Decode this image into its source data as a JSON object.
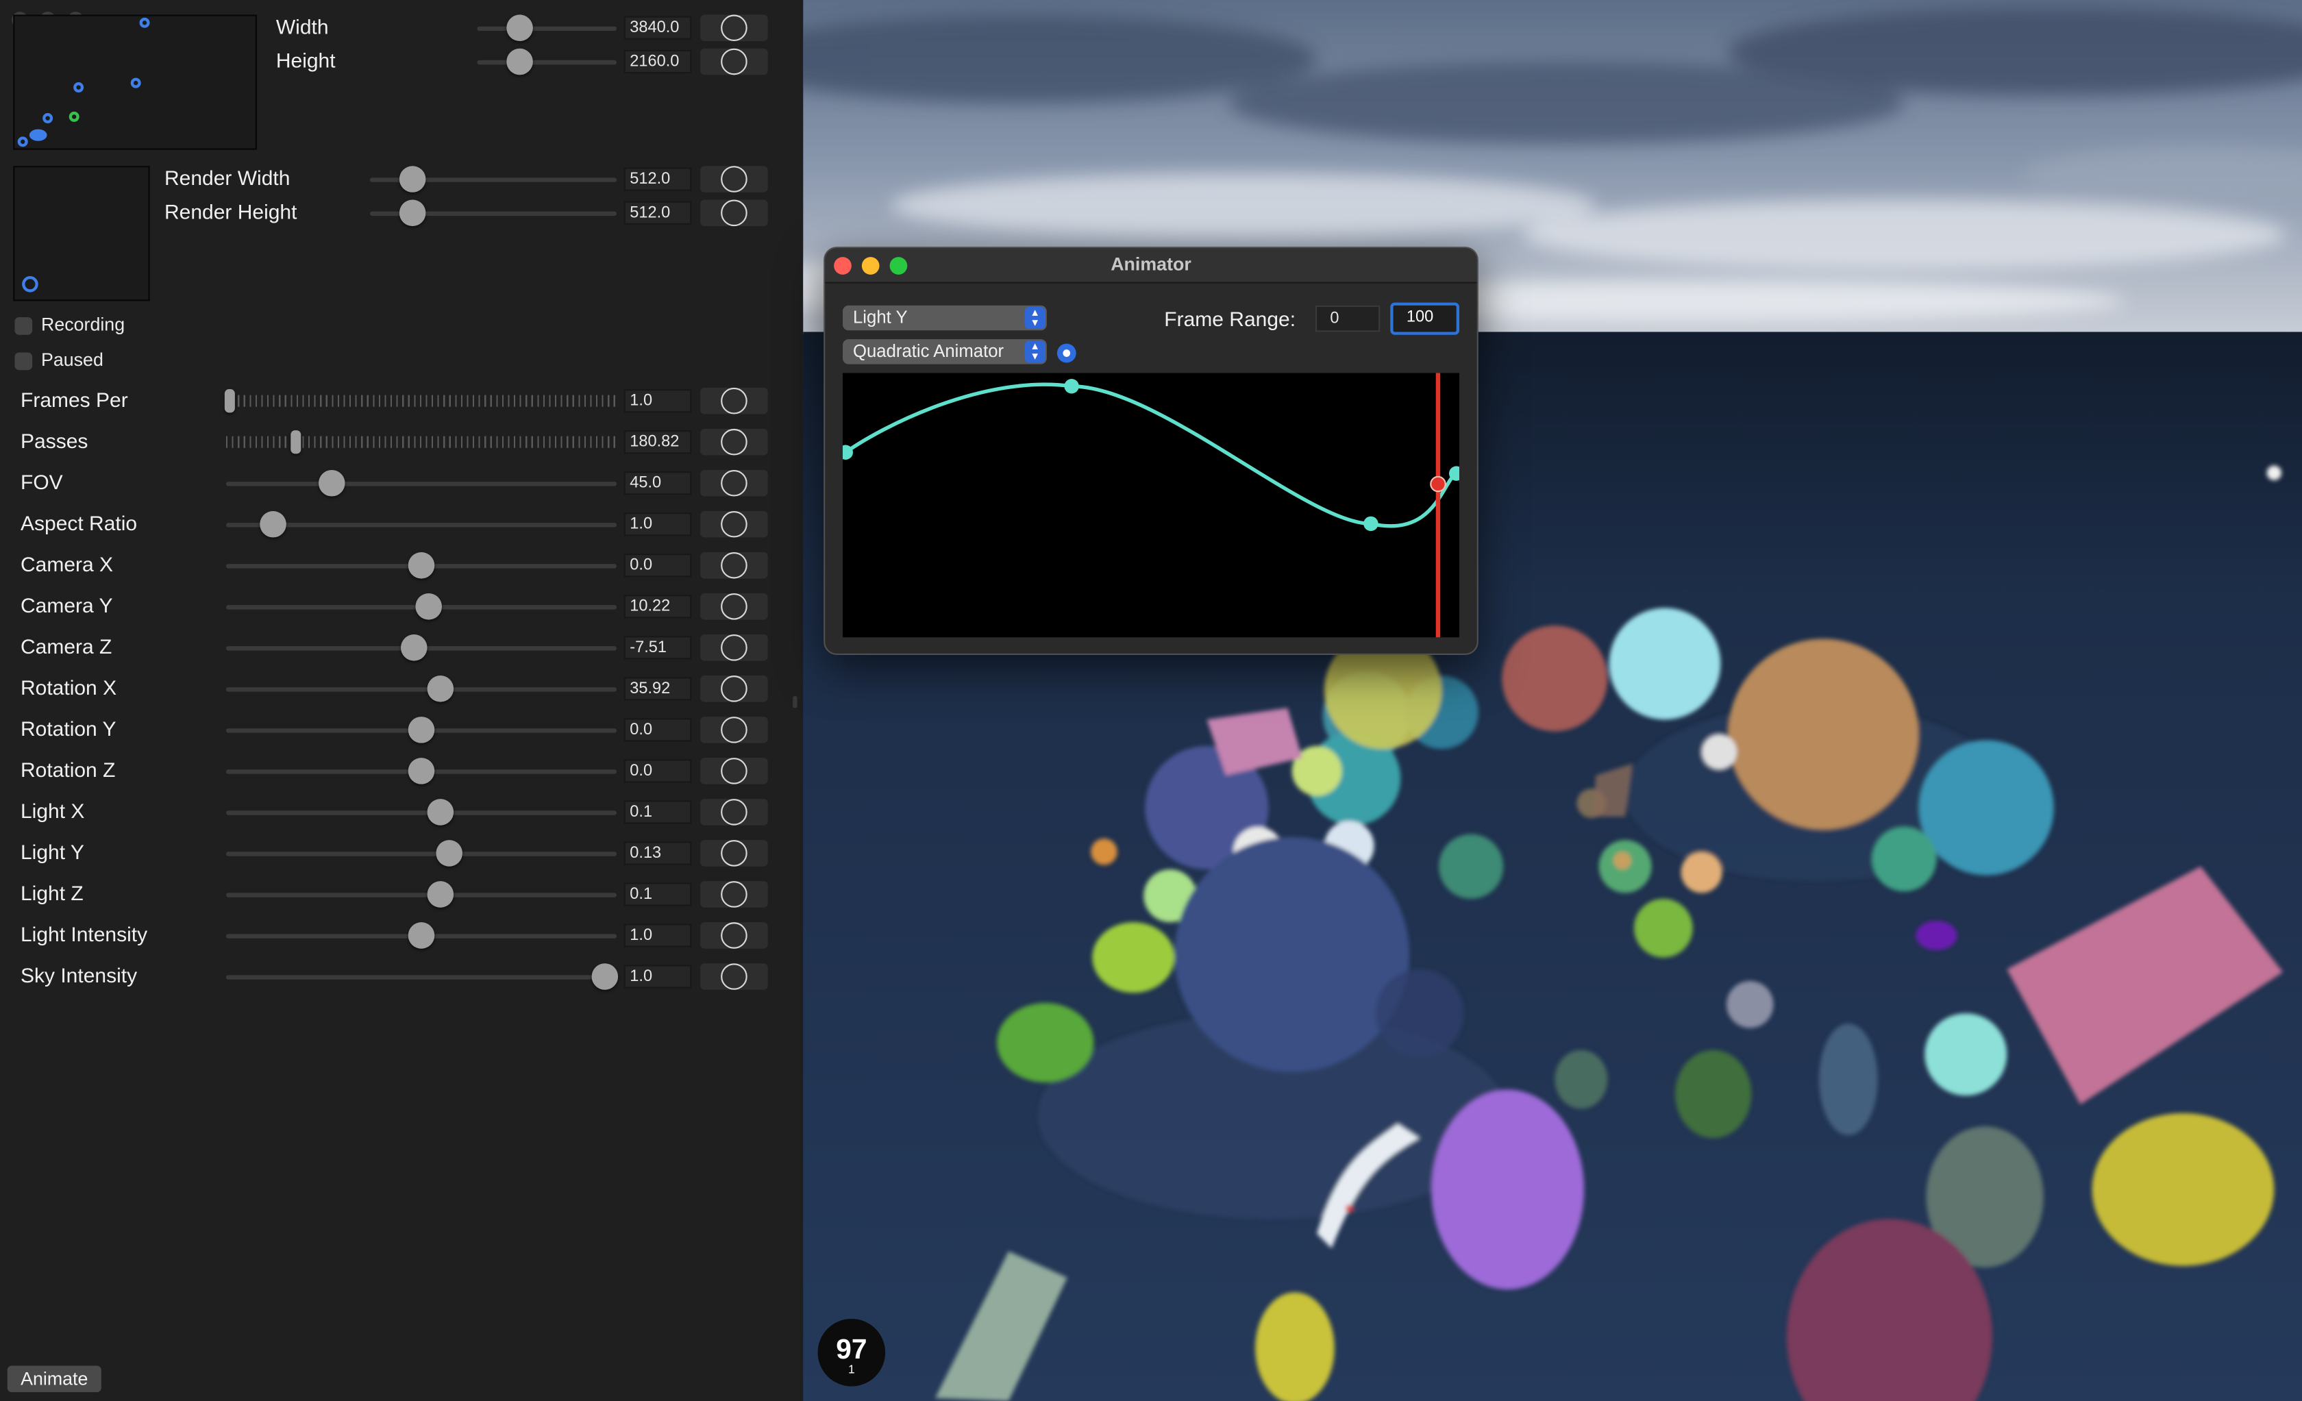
{
  "sidebar": {
    "size_controls": [
      {
        "label": "Width",
        "value": "3840.0",
        "slider_fraction": 0.31
      },
      {
        "label": "Height",
        "value": "2160.0",
        "slider_fraction": 0.31
      }
    ],
    "render_controls": [
      {
        "label": "Render Width",
        "value": "512.0",
        "slider_fraction": 0.17
      },
      {
        "label": "Render Height",
        "value": "512.0",
        "slider_fraction": 0.17
      }
    ],
    "checkboxes": [
      {
        "label": "Recording",
        "checked": false
      },
      {
        "label": "Paused",
        "checked": false
      }
    ],
    "params": [
      {
        "label": "Frames Per",
        "value": "1.0",
        "slider_fraction": 0.01,
        "ticked": true
      },
      {
        "label": "Passes",
        "value": "180.82",
        "slider_fraction": 0.18,
        "ticked": true
      },
      {
        "label": "FOV",
        "value": "45.0",
        "slider_fraction": 0.27
      },
      {
        "label": "Aspect Ratio",
        "value": "1.0",
        "slider_fraction": 0.12
      },
      {
        "label": "Camera X",
        "value": "0.0",
        "slider_fraction": 0.5
      },
      {
        "label": "Camera Y",
        "value": "10.22",
        "slider_fraction": 0.52
      },
      {
        "label": "Camera Z",
        "value": "-7.51",
        "slider_fraction": 0.48
      },
      {
        "label": "Rotation X",
        "value": "35.92",
        "slider_fraction": 0.55
      },
      {
        "label": "Rotation Y",
        "value": "0.0",
        "slider_fraction": 0.5
      },
      {
        "label": "Rotation Z",
        "value": "0.0",
        "slider_fraction": 0.5
      },
      {
        "label": "Light X",
        "value": "0.1",
        "slider_fraction": 0.55
      },
      {
        "label": "Light Y",
        "value": "0.13",
        "slider_fraction": 0.57
      },
      {
        "label": "Light Z",
        "value": "0.1",
        "slider_fraction": 0.55
      },
      {
        "label": "Light Intensity",
        "value": "1.0",
        "slider_fraction": 0.5
      },
      {
        "label": "Sky Intensity",
        "value": "1.0",
        "slider_fraction": 0.97
      }
    ],
    "animate_button": "Animate"
  },
  "viewport": {
    "fps": "97",
    "fps_sub": "1"
  },
  "animator": {
    "title": "Animator",
    "property_select": "Light Y",
    "animator_select": "Quadratic Animator",
    "frame_range_label": "Frame Range:",
    "frame_start": "0",
    "frame_end": "100",
    "curve_color": "#5ee0cc",
    "playhead_color": "#e0342b",
    "keyframes": [
      {
        "frame": 0,
        "value": 0.7
      },
      {
        "frame": 37,
        "value": 0.95
      },
      {
        "frame": 86,
        "value": 0.43
      },
      {
        "frame": 100,
        "value": 0.62
      }
    ],
    "playhead_frame": 97
  },
  "colors": {
    "accent": "#2f6ee0",
    "sidebar_bg": "#1f1f1f"
  }
}
